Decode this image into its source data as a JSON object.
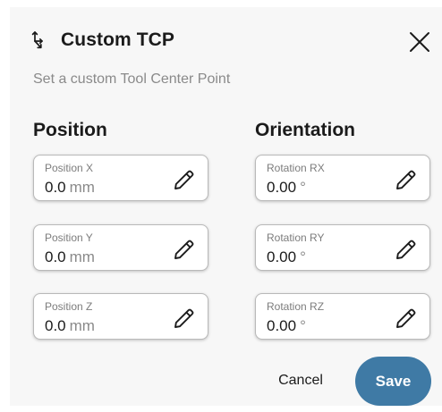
{
  "dialog": {
    "title": "Custom TCP",
    "subtitle": "Set a custom Tool Center Point",
    "title_icon": "axes-icon",
    "close_icon": "close-icon"
  },
  "position": {
    "heading": "Position",
    "fields": [
      {
        "label": "Position X",
        "value": "0.0",
        "unit": "mm"
      },
      {
        "label": "Position Y",
        "value": "0.0",
        "unit": "mm"
      },
      {
        "label": "Position Z",
        "value": "0.0",
        "unit": "mm"
      }
    ]
  },
  "orientation": {
    "heading": "Orientation",
    "fields": [
      {
        "label": "Rotation RX",
        "value": "0.00",
        "unit": "°"
      },
      {
        "label": "Rotation RY",
        "value": "0.00",
        "unit": "°"
      },
      {
        "label": "Rotation RZ",
        "value": "0.00",
        "unit": "°"
      }
    ]
  },
  "actions": {
    "cancel_label": "Cancel",
    "save_label": "Save"
  },
  "colors": {
    "primary": "#3f7aa5",
    "text": "#1b1b1b",
    "muted": "#8a8a8a"
  }
}
